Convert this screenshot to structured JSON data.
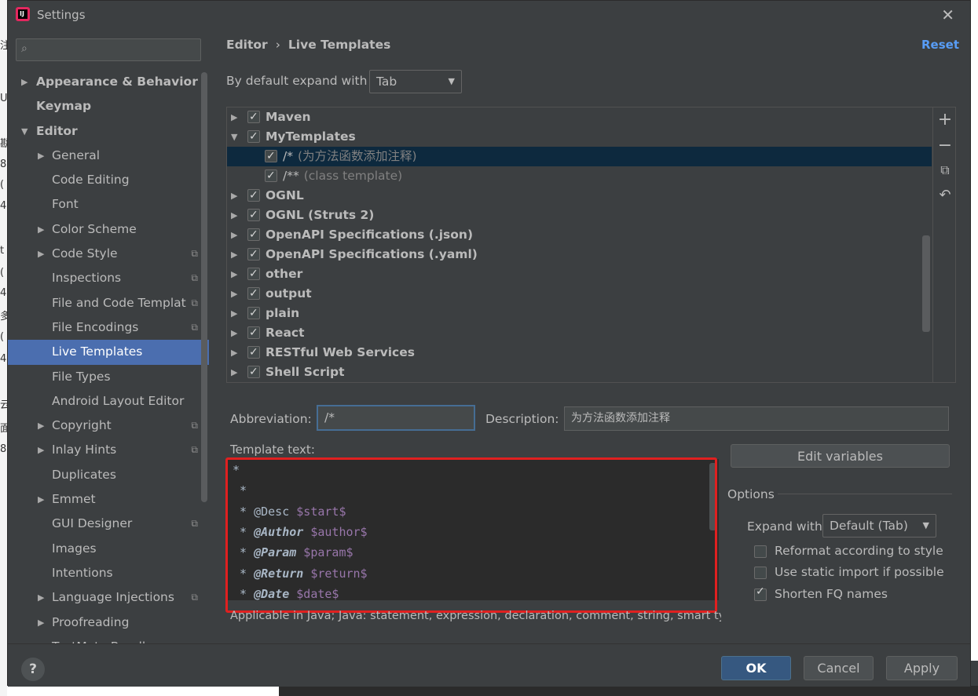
{
  "window": {
    "title": "Settings"
  },
  "search": {
    "placeholder": ""
  },
  "sidebar": {
    "items": [
      {
        "label": "Appearance & Behavior",
        "level": 0,
        "expandable": true,
        "expanded": false,
        "bold": true
      },
      {
        "label": "Keymap",
        "level": 0,
        "expandable": false,
        "bold": true
      },
      {
        "label": "Editor",
        "level": 0,
        "expandable": true,
        "expanded": true,
        "bold": true
      },
      {
        "label": "General",
        "level": 1,
        "expandable": true
      },
      {
        "label": "Code Editing",
        "level": 1
      },
      {
        "label": "Font",
        "level": 1
      },
      {
        "label": "Color Scheme",
        "level": 1,
        "expandable": true
      },
      {
        "label": "Code Style",
        "level": 1,
        "expandable": true,
        "copy": true
      },
      {
        "label": "Inspections",
        "level": 1,
        "copy": true
      },
      {
        "label": "File and Code Templat",
        "level": 1,
        "copy": true
      },
      {
        "label": "File Encodings",
        "level": 1,
        "copy": true
      },
      {
        "label": "Live Templates",
        "level": 1,
        "selected": true
      },
      {
        "label": "File Types",
        "level": 1
      },
      {
        "label": "Android Layout Editor",
        "level": 1
      },
      {
        "label": "Copyright",
        "level": 1,
        "expandable": true,
        "copy": true
      },
      {
        "label": "Inlay Hints",
        "level": 1,
        "expandable": true,
        "copy": true
      },
      {
        "label": "Duplicates",
        "level": 1
      },
      {
        "label": "Emmet",
        "level": 1,
        "expandable": true
      },
      {
        "label": "GUI Designer",
        "level": 1,
        "copy": true
      },
      {
        "label": "Images",
        "level": 1
      },
      {
        "label": "Intentions",
        "level": 1
      },
      {
        "label": "Language Injections",
        "level": 1,
        "expandable": true,
        "copy": true
      },
      {
        "label": "Proofreading",
        "level": 1,
        "expandable": true
      },
      {
        "label": "TextMate Bundl",
        "level": 1
      }
    ]
  },
  "main": {
    "breadcrumb": {
      "parent": "Editor",
      "current": "Live Templates"
    },
    "reset_label": "Reset",
    "expand_label": "By default expand with",
    "expand_value": "Tab",
    "templates": [
      {
        "label": "Maven",
        "checked": true,
        "bold": true,
        "level": 0,
        "expanded": false
      },
      {
        "label": "MyTemplates",
        "checked": true,
        "bold": true,
        "level": 0,
        "expanded": true
      },
      {
        "label": "/*",
        "desc": "(为方法函数添加注释)",
        "checked": true,
        "level": 1,
        "selected": true
      },
      {
        "label": "/**",
        "desc": "(class template)",
        "checked": true,
        "level": 1
      },
      {
        "label": "OGNL",
        "checked": true,
        "bold": true,
        "level": 0
      },
      {
        "label": "OGNL (Struts 2)",
        "checked": true,
        "bold": true,
        "level": 0
      },
      {
        "label": "OpenAPI Specifications (.json)",
        "checked": true,
        "bold": true,
        "level": 0
      },
      {
        "label": "OpenAPI Specifications (.yaml)",
        "checked": true,
        "bold": true,
        "level": 0
      },
      {
        "label": "other",
        "checked": true,
        "bold": true,
        "level": 0
      },
      {
        "label": "output",
        "checked": true,
        "bold": true,
        "level": 0
      },
      {
        "label": "plain",
        "checked": true,
        "bold": true,
        "level": 0
      },
      {
        "label": "React",
        "checked": true,
        "bold": true,
        "level": 0
      },
      {
        "label": "RESTful Web Services",
        "checked": true,
        "bold": true,
        "level": 0
      },
      {
        "label": "Shell Script",
        "checked": true,
        "bold": true,
        "level": 0
      }
    ],
    "abbreviation_label": "Abbreviation:",
    "abbreviation_value": "/*",
    "description_label": "Description:",
    "description_value": "为方法函数添加注释",
    "template_text_label": "Template text:",
    "template_lines": [
      {
        "plain": "*"
      },
      {
        "plain": " *"
      },
      {
        "plain": " * @Desc ",
        "var": "$start$"
      },
      {
        "plain": " * ",
        "tag": "@Author",
        "var": " $author$"
      },
      {
        "plain": " * ",
        "tag": "@Param",
        "var": " $param$"
      },
      {
        "plain": " * ",
        "tag": "@Return",
        "var": " $return$"
      },
      {
        "plain": " * ",
        "tag": "@Date",
        "var": " $date$"
      }
    ],
    "applicable_text": "Applicable in Java; Java: statement, expression, declaration, comment, string, smart typ",
    "edit_variables_label": "Edit variables",
    "options": {
      "title": "Options",
      "expand_with_label": "Expand with",
      "expand_with_value": "Default (Tab)",
      "reformat_label": "Reformat according to style",
      "reformat_checked": false,
      "static_import_label": "Use static import if possible",
      "static_import_checked": false,
      "shorten_fq_label": "Shorten FQ names",
      "shorten_fq_checked": true
    }
  },
  "footer": {
    "help_label": "?",
    "ok_label": "OK",
    "cancel_label": "Cancel",
    "apply_label": "Apply"
  },
  "colors": {
    "background": "#3c3f41",
    "selection": "#4b6eaf",
    "list_selection": "#0d293e",
    "link": "#589df6",
    "highlight_box": "#e02020",
    "ok_button": "#365880",
    "template_var": "#9876aa"
  }
}
